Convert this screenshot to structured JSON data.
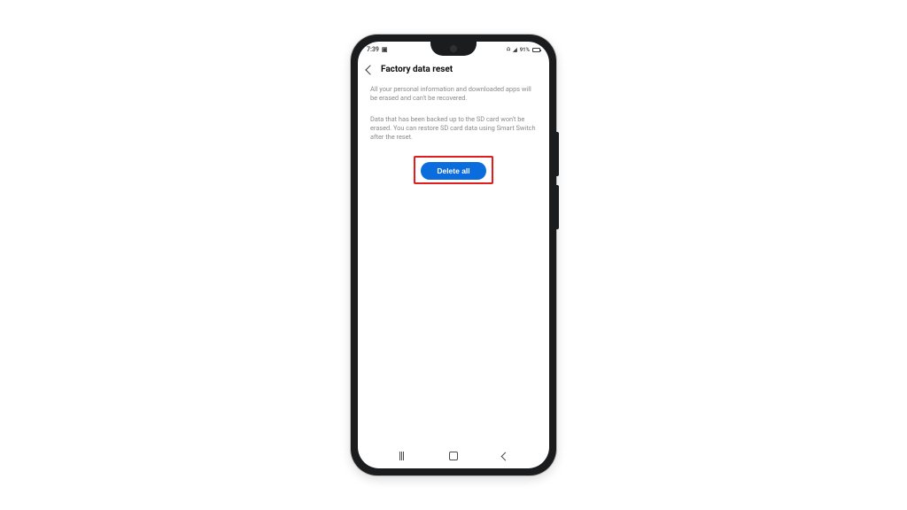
{
  "status": {
    "time": "7:39",
    "video_icon": "▸",
    "wifi_icon": "⋮",
    "signal_icon": "▮",
    "battery_text": "91%"
  },
  "header": {
    "title": "Factory data reset"
  },
  "body": {
    "para1": "All your personal information and downloaded apps will be erased and can't be recovered.",
    "para2": "Data that has been backed up to the SD card won't be erased. You can restore SD card data using Smart Switch after the reset."
  },
  "button": {
    "label": "Delete all"
  }
}
